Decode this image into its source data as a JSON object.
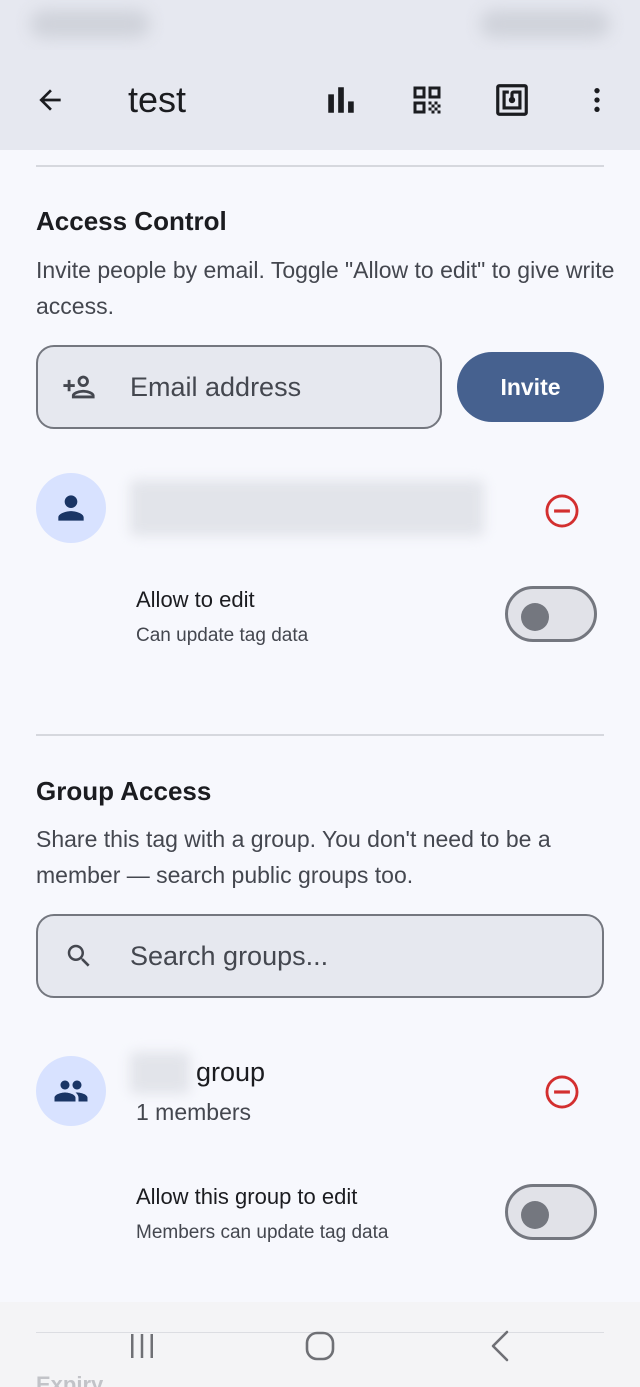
{
  "app_bar": {
    "title": "test",
    "icons": [
      "arrow-back-icon",
      "bar-chart-icon",
      "qr-code-icon",
      "nfc-icon",
      "more-vert-icon"
    ]
  },
  "access_control": {
    "title": "Access Control",
    "description": "Invite people by email. Toggle \"Allow to edit\" to give write access.",
    "email_placeholder": "Email address",
    "invite_label": "Invite",
    "member": {
      "allow_edit_label": "Allow to edit",
      "allow_edit_sub": "Can update tag data",
      "allow_edit_on": false
    }
  },
  "group_access": {
    "title": "Group Access",
    "description": "Share this tag with a group. You don't need to be a member — search public groups too.",
    "search_placeholder": "Search groups...",
    "group": {
      "name": "group",
      "members": "1 members",
      "allow_edit_label": "Allow this group to edit",
      "allow_edit_sub": "Members can update tag data",
      "allow_edit_on": false
    }
  },
  "next_section_partial": "Expiry",
  "colors": {
    "primary": "#46618f",
    "danger": "#d32f2f",
    "avatar_bg": "#d8e2ff",
    "app_bar_bg": "#e6e8f0"
  }
}
